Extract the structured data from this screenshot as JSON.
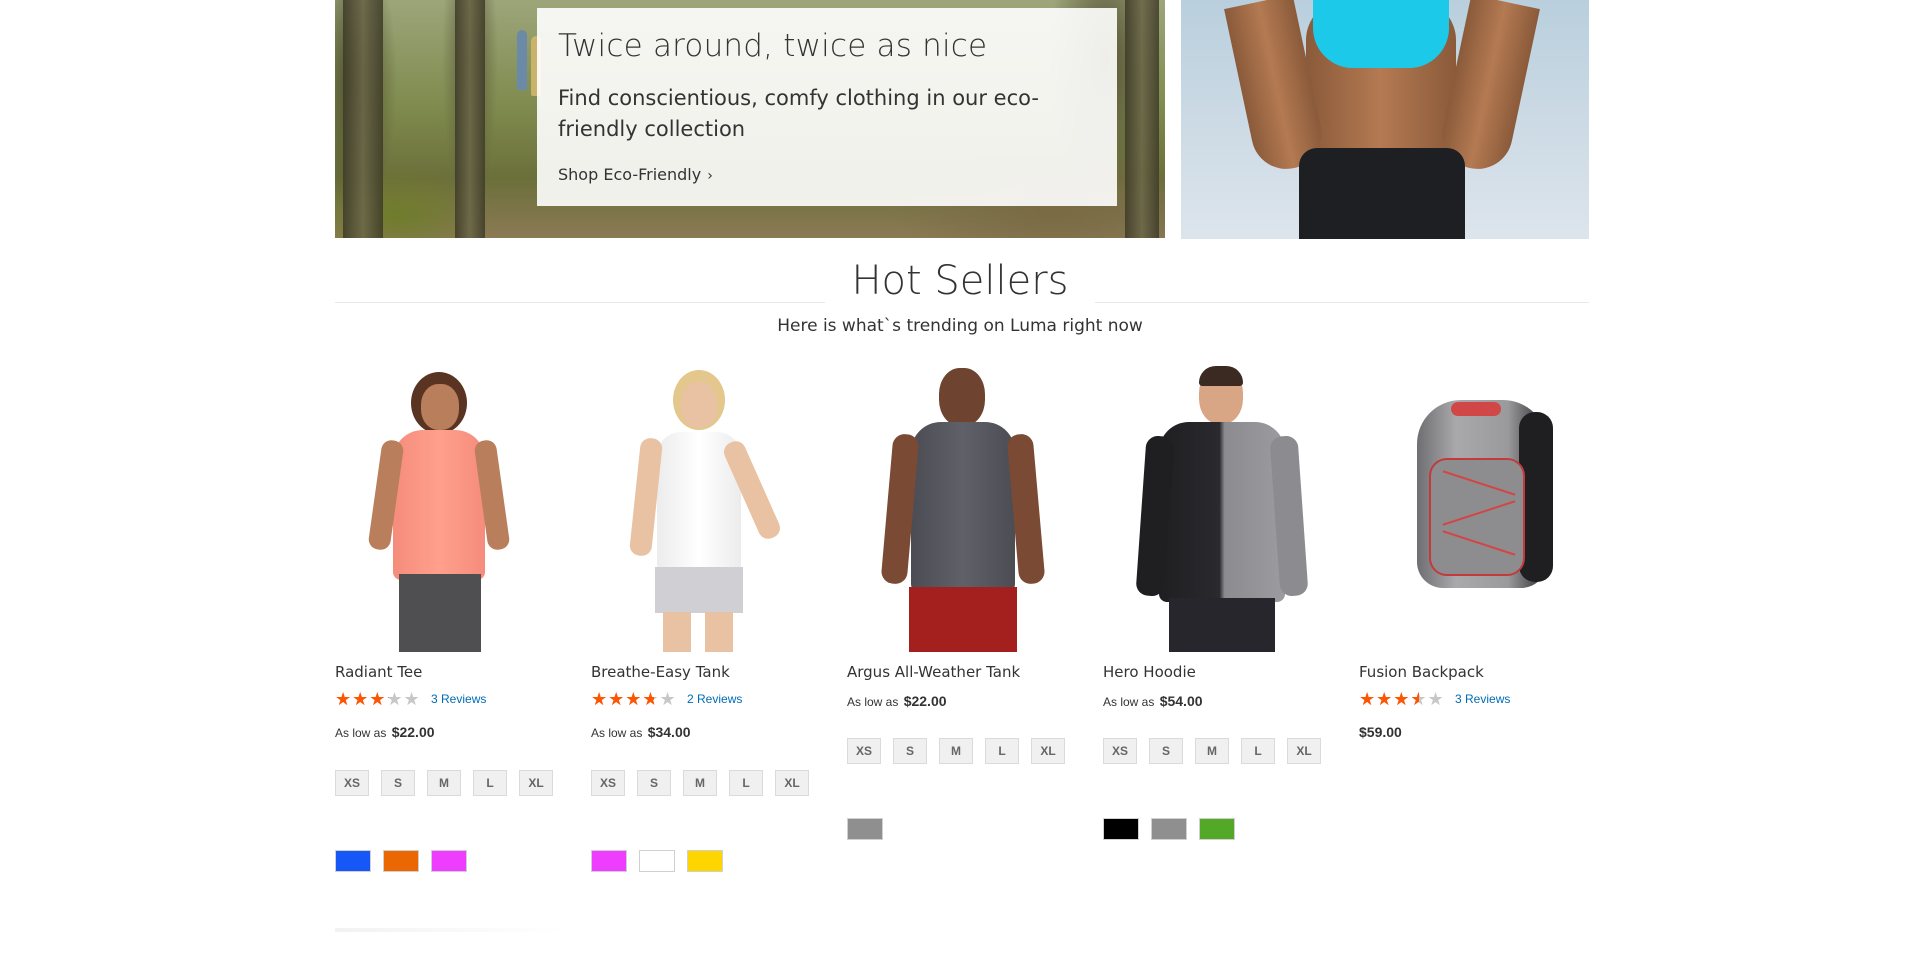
{
  "hero": {
    "eco": {
      "title": "Twice around, twice as nice",
      "subtitle": "Find conscientious, comfy clothing in our eco-friendly collection",
      "link_label": "Shop Eco-Friendly",
      "link_icon": "chevron-right-icon"
    }
  },
  "hot_sellers": {
    "title": "Hot Sellers",
    "subtitle": "Here is what`s trending on Luma right now"
  },
  "colors": {
    "star_filled": "#ff5501",
    "star_empty": "#c7c7c7",
    "review_link": "#006bb4"
  },
  "products": [
    {
      "name": "Radiant Tee",
      "rating_percent": 60,
      "reviews_label": "3 Reviews",
      "price_prefix": "As low as",
      "price": "$22.00",
      "sizes": [
        "XS",
        "S",
        "M",
        "L",
        "XL"
      ],
      "colors": [
        "#1857f7",
        "#eb6703",
        "#ef3dff"
      ]
    },
    {
      "name": "Breathe-Easy Tank",
      "rating_percent": 70,
      "reviews_label": "2 Reviews",
      "price_prefix": "As low as",
      "price": "$34.00",
      "sizes": [
        "XS",
        "S",
        "M",
        "L",
        "XL"
      ],
      "colors": [
        "#ef3dff",
        "#ffffff",
        "#ffd500"
      ]
    },
    {
      "name": "Argus All-Weather Tank",
      "price_prefix": "As low as",
      "price": "$22.00",
      "sizes": [
        "XS",
        "S",
        "M",
        "L",
        "XL"
      ],
      "colors": [
        "#8f8f8f"
      ]
    },
    {
      "name": "Hero Hoodie",
      "price_prefix": "As low as",
      "price": "$54.00",
      "sizes": [
        "XS",
        "S",
        "M",
        "L",
        "XL"
      ],
      "colors": [
        "#000000",
        "#8f8f8f",
        "#53a828"
      ]
    },
    {
      "name": "Fusion Backpack",
      "rating_percent": 67,
      "reviews_label": "3 Reviews",
      "price": "$59.00"
    }
  ]
}
